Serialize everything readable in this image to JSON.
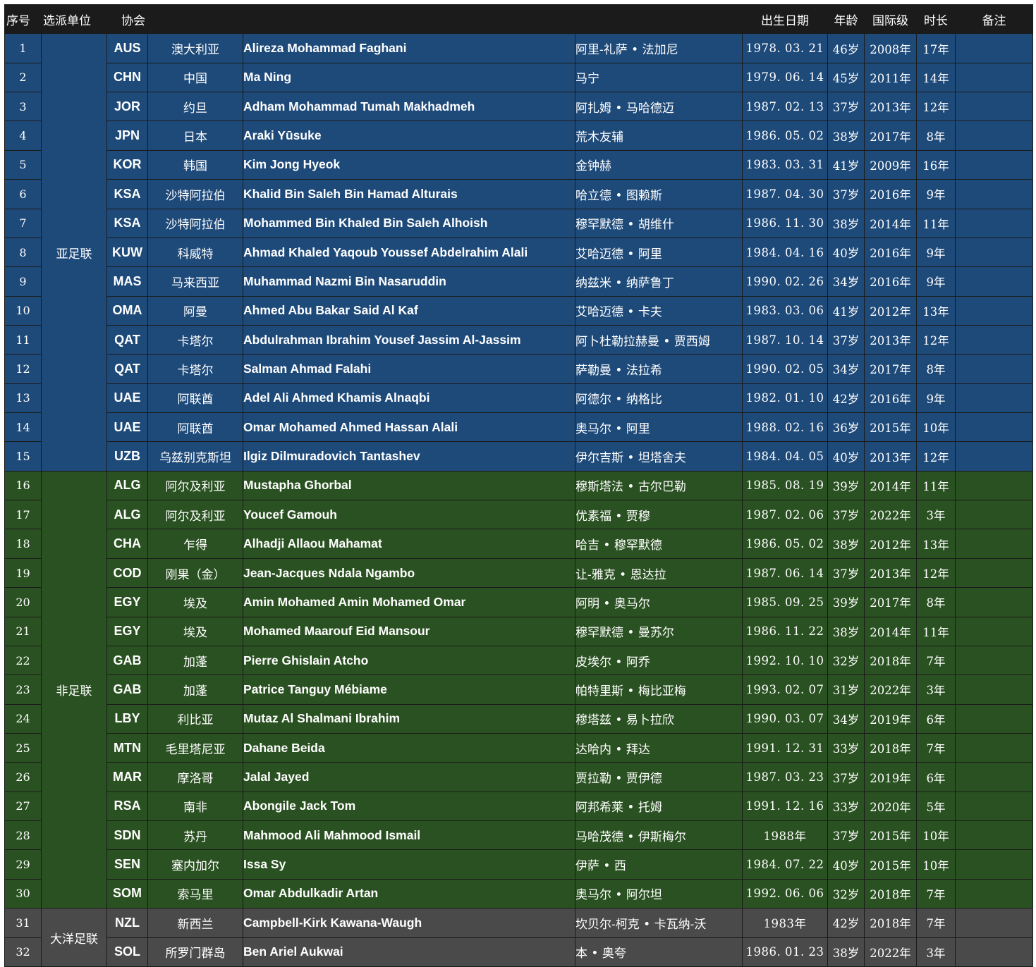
{
  "headers": {
    "no": "序号",
    "unit": "选派单位",
    "assoc": "协会",
    "dob": "出生日期",
    "age": "年龄",
    "intl": "国际级",
    "tenure": "时长",
    "note": "备注"
  },
  "colors": {
    "asia": "#1e4a7a",
    "africa": "#2a5121",
    "oceania": "#4a4a4a",
    "header": "#1b1b1b"
  },
  "confederations": [
    {
      "name": "亚足联",
      "group": "asia",
      "rows": 15
    },
    {
      "name": "非足联",
      "group": "africa",
      "rows": 15
    },
    {
      "name": "大洋足联",
      "group": "oceania",
      "rows": 2
    }
  ],
  "rows": [
    {
      "no": "1",
      "code": "AUS",
      "country": "澳大利亚",
      "en": "Alireza Mohammad Faghani",
      "cn": "阿里-礼萨 • 法加尼",
      "dob": "1978. 03. 21",
      "age": "46岁",
      "intl": "2008年",
      "tenure": "17年"
    },
    {
      "no": "2",
      "code": "CHN",
      "country": "中国",
      "en": "Ma Ning",
      "cn": "马宁",
      "dob": "1979. 06. 14",
      "age": "45岁",
      "intl": "2011年",
      "tenure": "14年"
    },
    {
      "no": "3",
      "code": "JOR",
      "country": "约旦",
      "en": "Adham Mohammad Tumah Makhadmeh",
      "cn": "阿扎姆 • 马哈德迈",
      "dob": "1987. 02. 13",
      "age": "37岁",
      "intl": "2013年",
      "tenure": "12年"
    },
    {
      "no": "4",
      "code": "JPN",
      "country": "日本",
      "en": "Araki Yūsuke",
      "cn": "荒木友辅",
      "dob": "1986. 05. 02",
      "age": "38岁",
      "intl": "2017年",
      "tenure": "8年"
    },
    {
      "no": "5",
      "code": "KOR",
      "country": "韩国",
      "en": "Kim Jong Hyeok",
      "cn": "金钟赫",
      "dob": "1983. 03. 31",
      "age": "41岁",
      "intl": "2009年",
      "tenure": "16年"
    },
    {
      "no": "6",
      "code": "KSA",
      "country": "沙特阿拉伯",
      "en": "Khalid Bin Saleh Bin Hamad Alturais",
      "cn": "哈立德 • 图赖斯",
      "dob": "1987. 04. 30",
      "age": "37岁",
      "intl": "2016年",
      "tenure": "9年"
    },
    {
      "no": "7",
      "code": "KSA",
      "country": "沙特阿拉伯",
      "en": "Mohammed Bin Khaled Bin Saleh Alhoish",
      "cn": "穆罕默德 • 胡维什",
      "dob": "1986. 11. 30",
      "age": "38岁",
      "intl": "2014年",
      "tenure": "11年"
    },
    {
      "no": "8",
      "code": "KUW",
      "country": "科威特",
      "en": "Ahmad Khaled Yaqoub Youssef Abdelrahim Alali",
      "cn": "艾哈迈德 • 阿里",
      "dob": "1984. 04. 16",
      "age": "40岁",
      "intl": "2016年",
      "tenure": "9年"
    },
    {
      "no": "9",
      "code": "MAS",
      "country": "马来西亚",
      "en": "Muhammad Nazmi Bin Nasaruddin",
      "cn": "纳兹米 • 纳萨鲁丁",
      "dob": "1990. 02. 26",
      "age": "34岁",
      "intl": "2016年",
      "tenure": "9年"
    },
    {
      "no": "10",
      "code": "OMA",
      "country": "阿曼",
      "en": "Ahmed Abu Bakar Said Al Kaf",
      "cn": "艾哈迈德 • 卡夫",
      "dob": "1983. 03. 06",
      "age": "41岁",
      "intl": "2012年",
      "tenure": "13年"
    },
    {
      "no": "11",
      "code": "QAT",
      "country": "卡塔尔",
      "en": "Abdulrahman Ibrahim Yousef Jassim Al-Jassim",
      "cn": "阿卜杜勒拉赫曼 • 贾西姆",
      "dob": "1987. 10. 14",
      "age": "37岁",
      "intl": "2013年",
      "tenure": "12年"
    },
    {
      "no": "12",
      "code": "QAT",
      "country": "卡塔尔",
      "en": "Salman Ahmad Falahi",
      "cn": "萨勒曼 • 法拉希",
      "dob": "1990. 02. 05",
      "age": "34岁",
      "intl": "2017年",
      "tenure": "8年"
    },
    {
      "no": "13",
      "code": "UAE",
      "country": "阿联酋",
      "en": "Adel Ali Ahmed Khamis Alnaqbi",
      "cn": "阿德尔 • 纳格比",
      "dob": "1982. 01. 10",
      "age": "42岁",
      "intl": "2016年",
      "tenure": "9年"
    },
    {
      "no": "14",
      "code": "UAE",
      "country": "阿联酋",
      "en": "Omar Mohamed Ahmed Hassan Alali",
      "cn": "奥马尔 • 阿里",
      "dob": "1988. 02. 16",
      "age": "36岁",
      "intl": "2015年",
      "tenure": "10年"
    },
    {
      "no": "15",
      "code": "UZB",
      "country": "乌兹别克斯坦",
      "en": "Ilgiz Dilmuradovich Tantashev",
      "cn": "伊尔吉斯 • 坦塔舍夫",
      "dob": "1984. 04. 05",
      "age": "40岁",
      "intl": "2013年",
      "tenure": "12年"
    },
    {
      "no": "16",
      "code": "ALG",
      "country": "阿尔及利亚",
      "en": "Mustapha Ghorbal",
      "cn": "穆斯塔法 • 古尔巴勒",
      "dob": "1985. 08. 19",
      "age": "39岁",
      "intl": "2014年",
      "tenure": "11年"
    },
    {
      "no": "17",
      "code": "ALG",
      "country": "阿尔及利亚",
      "en": "Youcef Gamouh",
      "cn": "优素福 • 贾穆",
      "dob": "1987. 02. 06",
      "age": "37岁",
      "intl": "2022年",
      "tenure": "3年"
    },
    {
      "no": "18",
      "code": "CHA",
      "country": "乍得",
      "en": "Alhadji Allaou Mahamat",
      "cn": "哈吉 • 穆罕默德",
      "dob": "1986. 05. 02",
      "age": "38岁",
      "intl": "2012年",
      "tenure": "13年"
    },
    {
      "no": "19",
      "code": "COD",
      "country": "刚果（金）",
      "en": "Jean-Jacques Ndala Ngambo",
      "cn": "让-雅克 • 恩达拉",
      "dob": "1987. 06. 14",
      "age": "37岁",
      "intl": "2013年",
      "tenure": "12年"
    },
    {
      "no": "20",
      "code": "EGY",
      "country": "埃及",
      "en": "Amin Mohamed Amin Mohamed Omar",
      "cn": "阿明 • 奥马尔",
      "dob": "1985. 09. 25",
      "age": "39岁",
      "intl": "2017年",
      "tenure": "8年"
    },
    {
      "no": "21",
      "code": "EGY",
      "country": "埃及",
      "en": "Mohamed Maarouf Eid Mansour",
      "cn": "穆罕默德 • 曼苏尔",
      "dob": "1986. 11. 22",
      "age": "38岁",
      "intl": "2014年",
      "tenure": "11年"
    },
    {
      "no": "22",
      "code": "GAB",
      "country": "加蓬",
      "en": "Pierre Ghislain Atcho",
      "cn": "皮埃尔 • 阿乔",
      "dob": "1992. 10. 10",
      "age": "32岁",
      "intl": "2018年",
      "tenure": "7年"
    },
    {
      "no": "23",
      "code": "GAB",
      "country": "加蓬",
      "en": "Patrice Tanguy Mébiame",
      "cn": "帕特里斯 • 梅比亚梅",
      "dob": "1993. 02. 07",
      "age": "31岁",
      "intl": "2022年",
      "tenure": "3年"
    },
    {
      "no": "24",
      "code": "LBY",
      "country": "利比亚",
      "en": "Mutaz Al Shalmani Ibrahim",
      "cn": "穆塔兹 • 易卜拉欣",
      "dob": "1990. 03. 07",
      "age": "34岁",
      "intl": "2019年",
      "tenure": "6年"
    },
    {
      "no": "25",
      "code": "MTN",
      "country": "毛里塔尼亚",
      "en": "Dahane Beida",
      "cn": "达哈内 • 拜达",
      "dob": "1991. 12. 31",
      "age": "33岁",
      "intl": "2018年",
      "tenure": "7年"
    },
    {
      "no": "26",
      "code": "MAR",
      "country": "摩洛哥",
      "en": "Jalal Jayed",
      "cn": "贾拉勒 • 贾伊德",
      "dob": "1987. 03. 23",
      "age": "37岁",
      "intl": "2019年",
      "tenure": "6年"
    },
    {
      "no": "27",
      "code": "RSA",
      "country": "南非",
      "en": "Abongile Jack Tom",
      "cn": "阿邦希莱 • 托姆",
      "dob": "1991. 12. 16",
      "age": "33岁",
      "intl": "2020年",
      "tenure": "5年"
    },
    {
      "no": "28",
      "code": "SDN",
      "country": "苏丹",
      "en": "Mahmood Ali Mahmood Ismail",
      "cn": "马哈茂德 • 伊斯梅尔",
      "dob": "1988年",
      "age": "37岁",
      "intl": "2015年",
      "tenure": "10年"
    },
    {
      "no": "29",
      "code": "SEN",
      "country": "塞内加尔",
      "en": "Issa Sy",
      "cn": "伊萨 • 西",
      "dob": "1984. 07. 22",
      "age": "40岁",
      "intl": "2015年",
      "tenure": "10年"
    },
    {
      "no": "30",
      "code": "SOM",
      "country": "索马里",
      "en": "Omar Abdulkadir Artan",
      "cn": "奥马尔 • 阿尔坦",
      "dob": "1992. 06. 06",
      "age": "32岁",
      "intl": "2018年",
      "tenure": "7年"
    },
    {
      "no": "31",
      "code": "NZL",
      "country": "新西兰",
      "en": "Campbell-Kirk Kawana-Waugh",
      "cn": "坎贝尔-柯克 • 卡瓦纳-沃",
      "dob": "1983年",
      "age": "42岁",
      "intl": "2018年",
      "tenure": "7年"
    },
    {
      "no": "32",
      "code": "SOL",
      "country": "所罗门群岛",
      "en": "Ben Ariel Aukwai",
      "cn": "本 • 奥夸",
      "dob": "1986. 01. 23",
      "age": "38岁",
      "intl": "2022年",
      "tenure": "3年"
    }
  ]
}
